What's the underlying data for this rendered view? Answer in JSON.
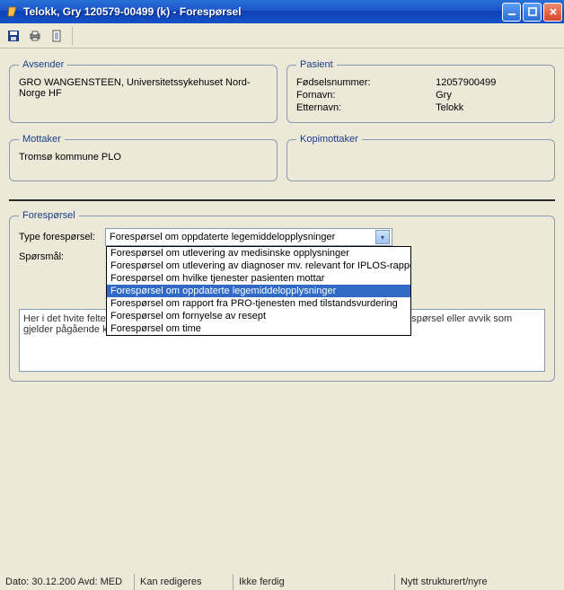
{
  "window": {
    "title": "Telokk, Gry 120579-00499 (k) - Forespørsel"
  },
  "sections": {
    "avsender": {
      "legend": "Avsender",
      "text": "GRO WANGENSTEEN, Universitetssykehuset Nord-Norge HF"
    },
    "pasient": {
      "legend": "Pasient",
      "fodselsnummer_label": "Fødselsnummer:",
      "fodselsnummer": "12057900499",
      "fornavn_label": "Fornavn:",
      "fornavn": "Gry",
      "etternavn_label": "Etternavn:",
      "etternavn": "Telokk"
    },
    "mottaker": {
      "legend": "Mottaker",
      "text": "Tromsø kommune PLO"
    },
    "kopimottaker": {
      "legend": "Kopimottaker",
      "text": ""
    },
    "foresporsel": {
      "legend": "Forespørsel",
      "type_label": "Type forespørsel:",
      "sporsmal_label": "Spørsmål:",
      "selected": "Forespørsel om oppdaterte legemiddelopplysninger",
      "options": [
        "Forespørsel om utlevering av medisinske opplysninger",
        "Forespørsel om utlevering av diagnoser mv. relevant for IPLOS-rapportering",
        "Forespørsel om hvilke tjenester pasienten mottar",
        "Forespørsel om oppdaterte legemiddelopplysninger",
        "Forespørsel om rapport fra PRO-tjenesten med tilstandsvurdering",
        "Forespørsel om fornyelse av resept",
        "Forespørsel om time"
      ],
      "selected_index": 3,
      "hint": "Her i det hvite feltet skriver du inn din forespørsel ang pasienten, svar på innkommet forespørsel eller avvik som gjelder pågående korrespondanse."
    }
  },
  "statusbar": {
    "cell1": "Dato: 30.12.200 Avd: MED",
    "cell2": "Kan redigeres",
    "cell3": "Ikke ferdig",
    "cell4": "Nytt strukturert/nyre"
  }
}
